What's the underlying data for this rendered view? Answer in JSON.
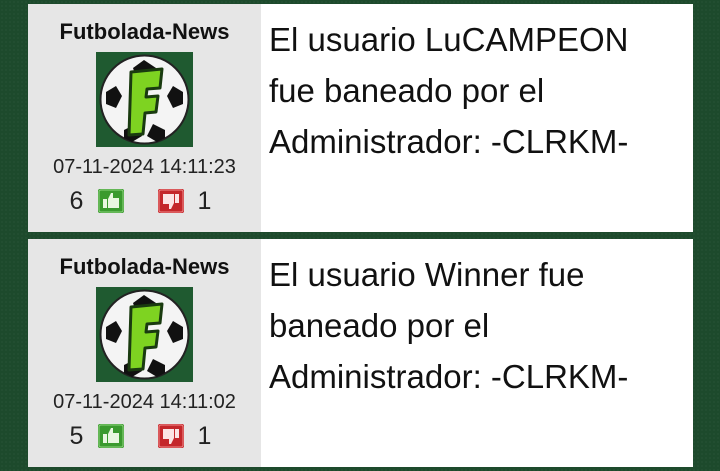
{
  "posts": [
    {
      "author": "Futbolada-News",
      "date": "07-11-2024 14:11:23",
      "likes": "6",
      "dislikes": "1",
      "message": "El usuario LuCAMPEON fue baneado por el Administrador: -CLRKM-"
    },
    {
      "author": "Futbolada-News",
      "date": "07-11-2024 14:11:02",
      "likes": "5",
      "dislikes": "1",
      "message": "El usuario Winner fue baneado por el Administrador: -CLRKM-"
    }
  ],
  "avatar": {
    "letter": "F",
    "icon": "soccer-ball-logo"
  },
  "icons": {
    "like": "thumbs-up-icon",
    "dislike": "thumbs-down-icon"
  },
  "colors": {
    "background": "#1d4a2c",
    "avatar_bg": "#1f5a30",
    "letter": "#7ed321",
    "like": "#3a9a2e",
    "dislike": "#c4262a"
  }
}
